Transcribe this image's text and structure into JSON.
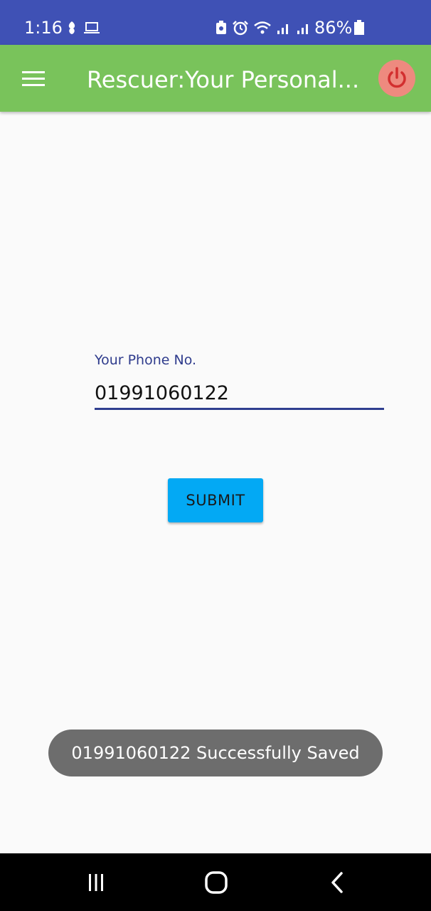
{
  "status_bar": {
    "time": "1:16",
    "battery": "86%",
    "left_icons": [
      "notification-icon",
      "laptop-icon"
    ],
    "right_icons": [
      "data-saver-icon",
      "alarm-icon",
      "wifi-icon",
      "signal-icon",
      "signal-icon",
      "battery-icon"
    ]
  },
  "app_bar": {
    "title": "Rescuer:Your Personal...",
    "color": "#79c35b",
    "menu_icon": "menu-icon",
    "power_icon": "power-icon"
  },
  "form": {
    "phone_label": "Your Phone No.",
    "phone_value": "01991060122",
    "submit_label": "SUBMIT",
    "submit_color": "#03a9f4"
  },
  "toast": {
    "message": "01991060122 Successfully Saved"
  },
  "nav_bar": {
    "buttons": [
      "recent-apps-icon",
      "home-icon",
      "back-icon"
    ]
  }
}
